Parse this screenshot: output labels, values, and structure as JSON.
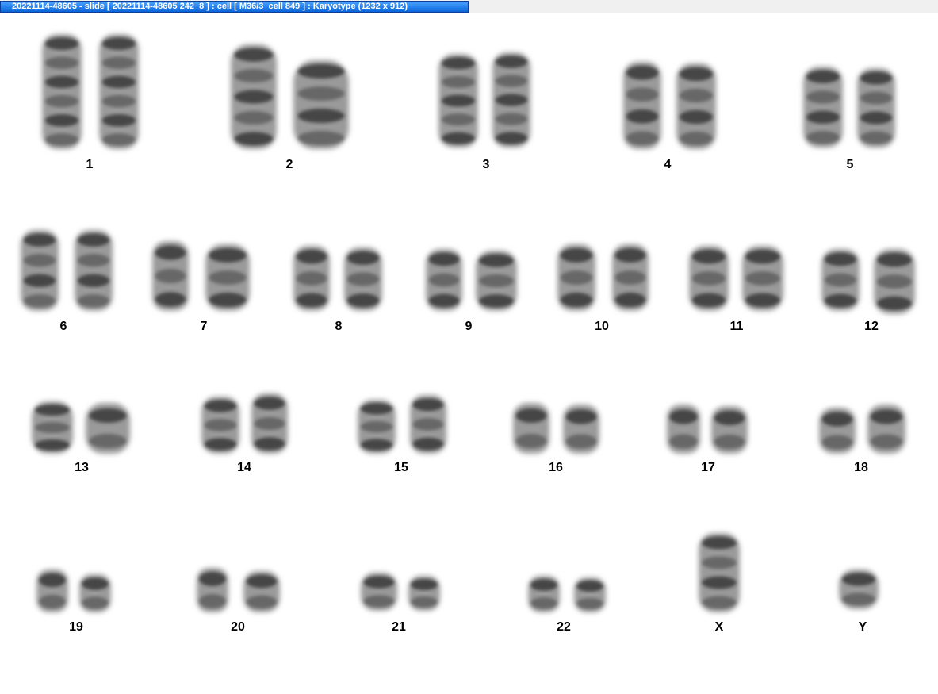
{
  "window": {
    "title": "20221114-48605 - slide [ 20221114-48605 242_8 ] : cell [ M36/3_cell 849 ] : Karyotype  (1232 x 912)"
  },
  "karyotype": {
    "labels": [
      "1",
      "2",
      "3",
      "4",
      "5",
      "6",
      "7",
      "8",
      "9",
      "10",
      "11",
      "12",
      "13",
      "14",
      "15",
      "16",
      "17",
      "18",
      "19",
      "20",
      "21",
      "22",
      "X",
      "Y"
    ]
  },
  "colors": {
    "titlebar_accent": "#0a64d8",
    "chromosome_dark": "#2a2a2a",
    "chromosome_light": "#9a9a9a"
  }
}
